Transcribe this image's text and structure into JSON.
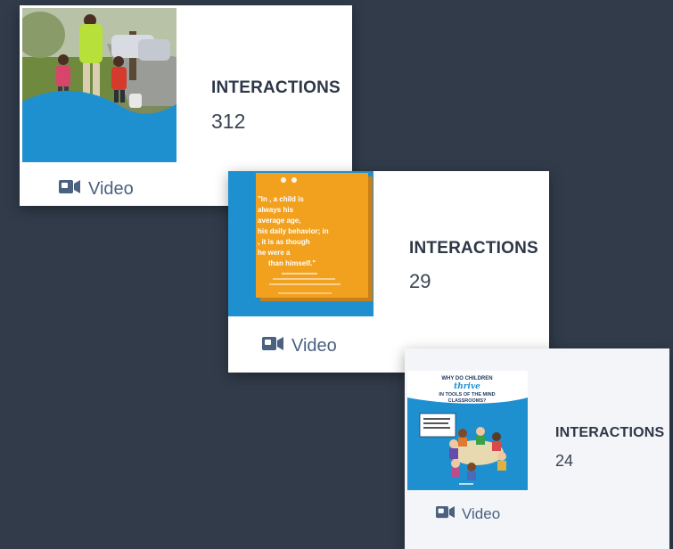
{
  "cards": [
    {
      "stat_label": "INTERACTIONS",
      "stat_value": "312",
      "media_type": "Video",
      "thumbnail_icon": "photo-family-walking",
      "wave_color": "#1e90d0"
    },
    {
      "stat_label": "INTERACTIONS",
      "stat_value": "29",
      "media_type": "Video",
      "thumbnail_icon": "quote-card",
      "thumbnail_quote": "\"In ___ a child is always ___ his average age, his daily behavior; in ___ it is as though he were a ___ than himself.\"",
      "background_color": "#1e90d0",
      "card_color": "#f2a11f"
    },
    {
      "stat_label": "INTERACTIONS",
      "stat_value": "24",
      "media_type": "Video",
      "thumbnail_icon": "infographic-classroom",
      "thumbnail_title_lines": [
        "WHY DO CHILDREN",
        "thrive",
        "IN TOOLS OF THE MIND",
        "CLASSROOMS?"
      ],
      "background_color": "#1e90d0"
    }
  ],
  "colors": {
    "page_background": "#313b4a",
    "video_icon": "#4a6180"
  }
}
